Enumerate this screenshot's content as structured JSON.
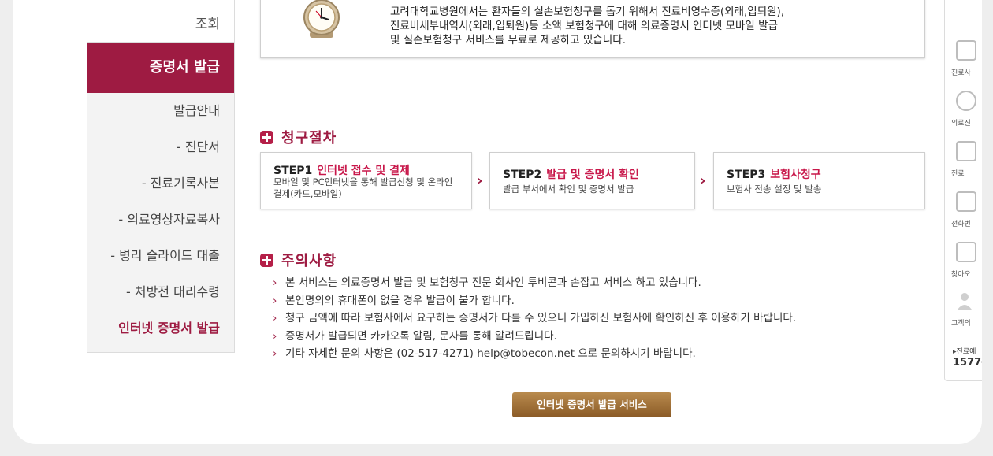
{
  "sidebar": {
    "top_item": "조회",
    "active": "증명서 발급",
    "items": [
      {
        "label": "발급안내"
      },
      {
        "label": "- 진단서"
      },
      {
        "label": "- 진료기록사본"
      },
      {
        "label": "- 의료영상자료복사"
      },
      {
        "label": "- 병리 슬라이드 대출"
      },
      {
        "label": "- 처방전 대리수령"
      },
      {
        "label": "인터넷 증명서 발급"
      }
    ]
  },
  "info": {
    "line1": "고려대학교병원에서는 환자들의 실손보험청구를 돕기 위해서 진료비영수증(외래,입퇴원),",
    "line2": "진료비세부내역서(외래,입퇴원)등 소액 보험청구에 대해 의료증명서 인터넷 모바일 발급",
    "line3": "및 실손보험청구 서비스를 무료로 제공하고 있습니다."
  },
  "process": {
    "title": "청구절차",
    "steps": [
      {
        "num": "STEP1",
        "name": "인터넷 접수 및 결제",
        "desc1": "모바일 및 PC인터넷을 통해 발급신청 및 온라인",
        "desc2": "결제(카드,모바일)"
      },
      {
        "num": "STEP2",
        "name": "발급 및 증명서 확인",
        "desc1": "발급 부서에서 확인 및 증명서 발급",
        "desc2": ""
      },
      {
        "num": "STEP3",
        "name": "보험사청구",
        "desc1": "보험사 전송 설정 및 발송",
        "desc2": ""
      }
    ],
    "arrow": "›"
  },
  "notice": {
    "title": "주의사항",
    "bullet": "›",
    "items": [
      "본 서비스는 의료증명서 발급 및 보험청구 전문 회사인 투비콘과 손잡고 서비스 하고 있습니다.",
      "본인명의의 휴대폰이 없을 경우 발급이 불가 합니다.",
      "청구 금액에 따라 보험사에서 요구하는 증명서가 다를 수 있으니 가입하신 보험사에 확인하신 후 이용하기 바랍니다.",
      "증명서가 발급되면 카카오톡 알림, 문자를 통해 알려드립니다.",
      "기타 자세한 문의 사항은 (02-517-4271) help@tobecon.net 으로 문의하시기 바랍니다."
    ]
  },
  "cta_button": "인터넷 증명서 발급 서비스",
  "right_panel": {
    "items": [
      {
        "label": "진료사",
        "icon": "document-icon"
      },
      {
        "label": "의료진",
        "icon": "doctor-icon"
      },
      {
        "label": "진료",
        "icon": "clipboard-icon"
      },
      {
        "label": "전화번",
        "icon": "phone-icon"
      },
      {
        "label": "찾아오",
        "icon": "map-icon"
      },
      {
        "label": "고객의",
        "icon": "person-icon"
      }
    ],
    "phone_label": "▸진료예",
    "phone": "1577-"
  },
  "colors": {
    "accent": "#9e1b42",
    "step_red": "#c8174a",
    "button": "#a0733a"
  }
}
